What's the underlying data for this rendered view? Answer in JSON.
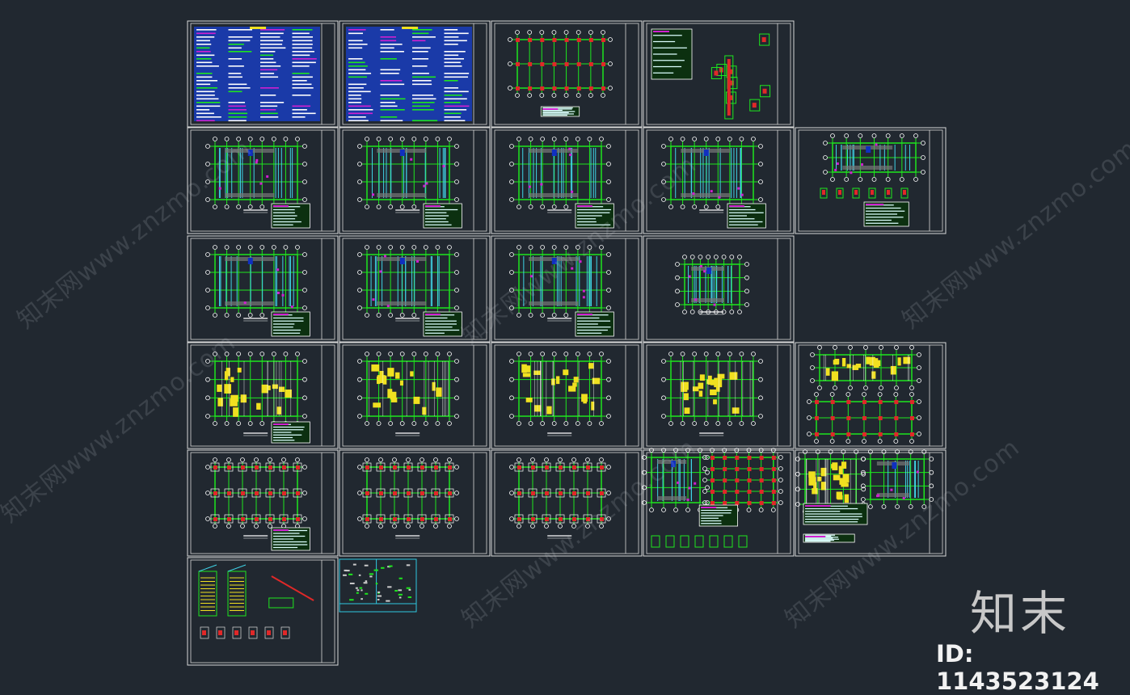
{
  "watermark": {
    "text": "知末网www.znzmo.com"
  },
  "logo": {
    "text": "知末"
  },
  "id_label": "ID: 1143523124",
  "colors": {
    "background": "#212830",
    "sheet_border": "#d8d8d8",
    "grid": "#1ee61e",
    "beam": "#3fd3e6",
    "slab": "#f0e020",
    "column": "#e02828",
    "notes": "#1a3aa8",
    "magenta": "#d020d0",
    "special_border": "#30c8e0"
  },
  "sheets": [
    [
      "notes",
      "notes",
      "column-grid",
      "details"
    ],
    [
      "beam-plan",
      "beam-plan",
      "beam-plan",
      "beam-plan",
      "roof-plan"
    ],
    [
      "beam-plan",
      "beam-plan",
      "beam-plan",
      "small-plan"
    ],
    [
      "slab-plan",
      "slab-plan",
      "slab-plan",
      "slab-plan",
      "slab-roof"
    ],
    [
      "foundation",
      "foundation",
      "foundation",
      "stair-details",
      "stair-details"
    ],
    [
      "section-details",
      "rebar-strip"
    ]
  ]
}
